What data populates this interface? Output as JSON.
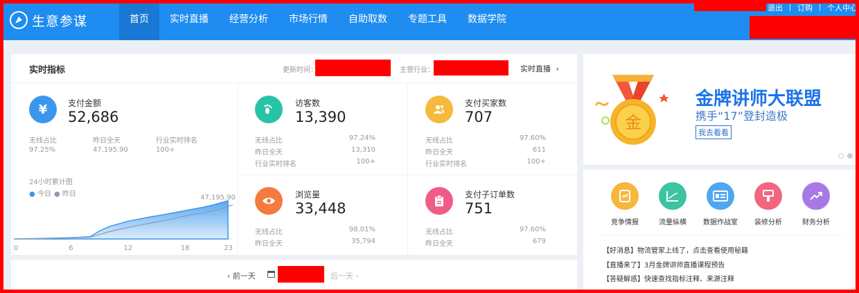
{
  "header": {
    "logo_text": "生意参谋",
    "nav": [
      "首页",
      "实时直播",
      "经营分析",
      "市场行情",
      "自助取数",
      "专题工具",
      "数据学院"
    ],
    "links": [
      "退出",
      "订购",
      "个人中心"
    ]
  },
  "realtime": {
    "title": "实时指标",
    "updated_label": "更新时间：",
    "industry_label": "主营行业：",
    "live_link": "实时直播",
    "payment": {
      "label": "支付金额",
      "value": "52,686",
      "icon": "yen-icon",
      "stats": [
        {
          "label": "无线占比",
          "value": "97.25%"
        },
        {
          "label": "昨日全天",
          "value": "47,195.90"
        },
        {
          "label": "行业实时排名",
          "value": "100+"
        }
      ]
    },
    "visitors": {
      "label": "访客数",
      "value": "13,390",
      "icon": "footprint-icon",
      "rows": [
        {
          "label": "无线占比",
          "value": "97.24%"
        },
        {
          "label": "昨日全天",
          "value": "13,310"
        },
        {
          "label": "行业实时排名",
          "value": "100+"
        }
      ]
    },
    "buyers": {
      "label": "支付买家数",
      "value": "707",
      "icon": "users-icon",
      "rows": [
        {
          "label": "无线占比",
          "value": "97.60%"
        },
        {
          "label": "昨日全天",
          "value": "611"
        },
        {
          "label": "行业实时排名",
          "value": "100+"
        }
      ]
    },
    "pageviews": {
      "label": "浏览量",
      "value": "33,448",
      "icon": "eye-icon",
      "rows": [
        {
          "label": "无线占比",
          "value": "98.01%"
        },
        {
          "label": "昨日全天",
          "value": "35,794"
        }
      ]
    },
    "suborders": {
      "label": "支付子订单数",
      "value": "751",
      "icon": "clipboard-icon",
      "rows": [
        {
          "label": "无线占比",
          "value": "97.60%"
        },
        {
          "label": "昨日全天",
          "value": "679"
        }
      ]
    }
  },
  "chart_data": {
    "type": "area",
    "title": "24小时累计图",
    "series": [
      {
        "name": "今日",
        "color": "#3b97ee"
      },
      {
        "name": "昨日",
        "color": "#8b9bb0"
      }
    ],
    "x_ticks": [
      "0",
      "6",
      "12",
      "18",
      "23"
    ],
    "end_label": "47,195.90",
    "xlim": [
      0,
      23
    ],
    "today": {
      "x": [
        0,
        3,
        6,
        8,
        9,
        10,
        12,
        14,
        16,
        18,
        20,
        21,
        22.5
      ],
      "y": [
        0,
        800,
        1800,
        3000,
        11000,
        17000,
        24500,
        29500,
        34000,
        39000,
        44000,
        47000,
        52686
      ]
    },
    "yesterday": {
      "x": [
        0,
        3,
        6,
        8,
        9,
        10,
        12,
        14,
        16,
        18,
        20,
        22,
        23
      ],
      "y": [
        0,
        600,
        1500,
        2500,
        6000,
        10000,
        16000,
        21000,
        26000,
        31500,
        36000,
        42000,
        47195.9
      ]
    },
    "ylim": [
      0,
      60000
    ]
  },
  "datebar": {
    "prev": "前一天",
    "next": "后一天"
  },
  "banner": {
    "title": "金牌讲师大联盟",
    "subtitle": "携手“17”登封造极",
    "button": "我去看看",
    "medal_char": "金"
  },
  "tools": [
    {
      "label": "竞争情报",
      "color": "#f6b73c",
      "icon": "report-icon"
    },
    {
      "label": "流量纵横",
      "color": "#3cc5a0",
      "icon": "traffic-chart-icon"
    },
    {
      "label": "数据作战室",
      "color": "#4fa7f3",
      "icon": "dashboard-icon"
    },
    {
      "label": "装修分析",
      "color": "#f2667f",
      "icon": "brush-icon"
    },
    {
      "label": "财务分析",
      "color": "#a879e6",
      "icon": "trend-icon"
    }
  ],
  "news": [
    {
      "tag": "【好消息】",
      "text": "物流管家上线了，点击查看使用秘籍"
    },
    {
      "tag": "【直播来了】",
      "text": "3月金牌讲师直播课程预告"
    },
    {
      "tag": "【答疑解惑】",
      "text": "快速查找指标注释、来源注释"
    }
  ]
}
